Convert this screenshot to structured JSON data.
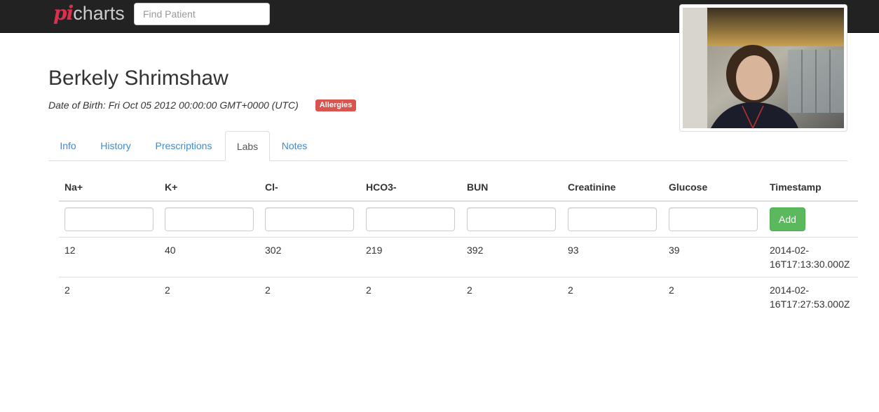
{
  "app": {
    "brand_prefix": "pi",
    "brand_suffix": "charts"
  },
  "search": {
    "placeholder": "Find Patient",
    "value": ""
  },
  "patient": {
    "name": "Berkely Shrimshaw",
    "dob": "Date of Birth: Fri Oct 05 2012 00:00:00 GMT+0000 (UTC)",
    "badge": "Allergies"
  },
  "tabs": [
    {
      "label": "Info",
      "active": false
    },
    {
      "label": "History",
      "active": false
    },
    {
      "label": "Prescriptions",
      "active": false
    },
    {
      "label": "Labs",
      "active": true
    },
    {
      "label": "Notes",
      "active": false
    }
  ],
  "labs": {
    "headers": [
      "Na+",
      "K+",
      "Cl-",
      "HCO3-",
      "BUN",
      "Creatinine",
      "Glucose",
      "Timestamp"
    ],
    "add_label": "Add",
    "rows": [
      [
        "12",
        "40",
        "302",
        "219",
        "392",
        "93",
        "39",
        "2014-02-16T17:13:30.000Z"
      ],
      [
        "2",
        "2",
        "2",
        "2",
        "2",
        "2",
        "2",
        "2014-02-16T17:27:53.000Z"
      ]
    ]
  },
  "colors": {
    "navbar": "#222222",
    "brand_accent": "#d9304b",
    "link": "#428bca",
    "badge": "#d9534f",
    "add_button": "#5cb85c"
  }
}
